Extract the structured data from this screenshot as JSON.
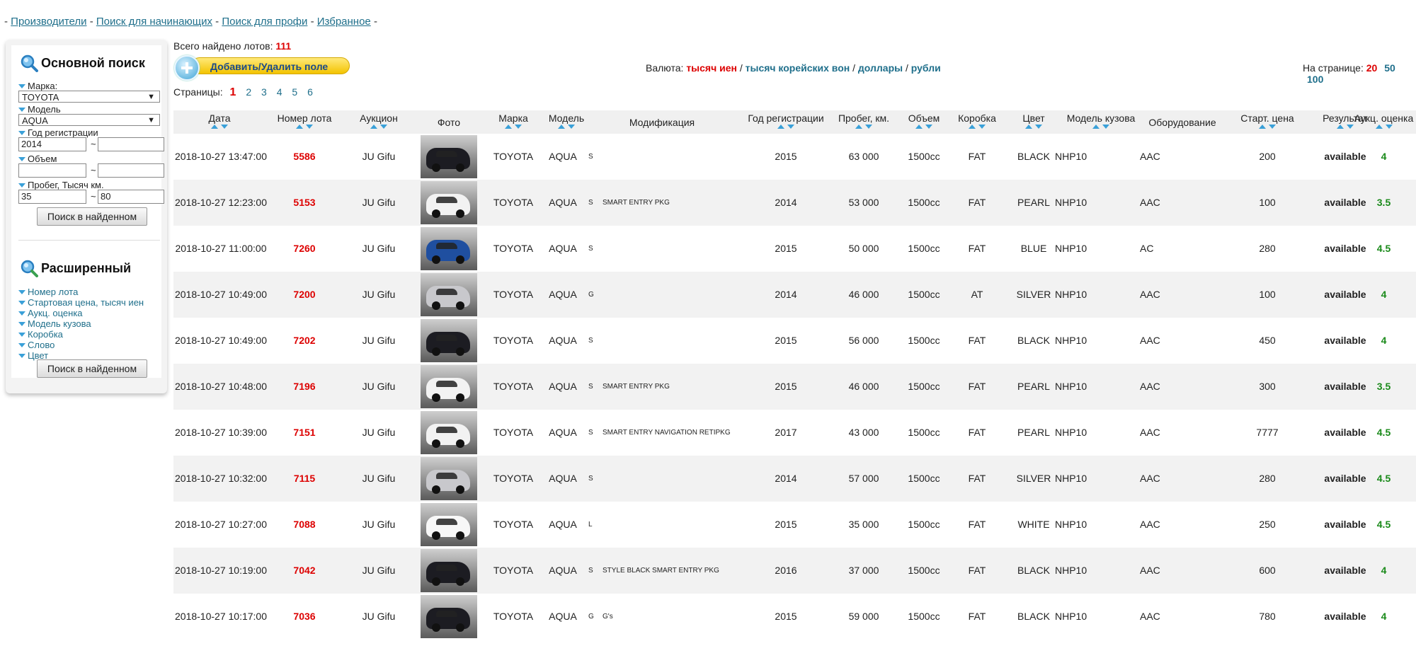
{
  "nav": {
    "prefix": "-",
    "links": [
      "Производители",
      "Поиск для начинающих",
      "Поиск для профи",
      "Избранное"
    ],
    "sep": "-"
  },
  "sidebar": {
    "basic_title": "Основной поиск",
    "make_label": "Марка:",
    "make_value": "TOYOTA",
    "model_label": "Модель",
    "model_value": "AQUA",
    "year_label": "Год регистрации",
    "year_from": "2014",
    "year_to": "",
    "volume_label": "Объем",
    "volume_from": "",
    "volume_to": "",
    "mileage_label": "Пробег, Тысяч км.",
    "mileage_from": "35",
    "mileage_to": "80",
    "tilde": "~",
    "search_button": "Поиск в найденном",
    "advanced_title": "Расширенный",
    "advanced_links": [
      "Номер лота",
      "Стартовая цена, тысяч иен",
      "Аукц. оценка",
      "Модель кузова",
      "Коробка",
      "Слово",
      "Цвет"
    ],
    "search_button_2": "Поиск в найденном"
  },
  "summary": {
    "found_label": "Всего найдено лотов:",
    "found_count": "111",
    "add_field_button": "Добавить/Удалить поле",
    "currency_label": "Валюта:",
    "currency_selected": "тысяч иен",
    "currency_options": [
      "тысяч корейских вон",
      "доллары",
      "рубли"
    ],
    "per_page_label": "На странице:",
    "per_page_selected": "20",
    "per_page_options": [
      "50",
      "100"
    ],
    "pages_label": "Страницы:",
    "current_page": "1",
    "pages": [
      "2",
      "3",
      "4",
      "5",
      "6"
    ]
  },
  "columns": [
    "Дата",
    "Номер лота",
    "Аукцион",
    "Фото",
    "Марка",
    "Модель",
    "Модификация",
    "Год регистрации",
    "Пробег, км.",
    "Объем",
    "Коробка",
    "Цвет",
    "Модель кузова",
    "Оборудование",
    "Старт. цена",
    "Результат",
    "Аукц. оценка"
  ],
  "rows": [
    {
      "date": "2018-10-27 13:47:00",
      "lot": "5586",
      "auction": "JU Gifu",
      "make": "TOYOTA",
      "model": "AQUA",
      "grade": "S",
      "mod": "",
      "year": "2015",
      "mileage": "63 000",
      "volume": "1500cc",
      "gearbox": "FAT",
      "color": "BLACK",
      "body": "NHP10",
      "equip": "AAC",
      "start": "200",
      "result": "available",
      "score": "4",
      "car_color": "#1c1c22"
    },
    {
      "date": "2018-10-27 12:23:00",
      "lot": "5153",
      "auction": "JU Gifu",
      "make": "TOYOTA",
      "model": "AQUA",
      "grade": "S",
      "mod": "SMART ENTRY PKG",
      "year": "2014",
      "mileage": "53 000",
      "volume": "1500cc",
      "gearbox": "FAT",
      "color": "PEARL",
      "body": "NHP10",
      "equip": "AAC",
      "start": "100",
      "result": "available",
      "score": "3.5",
      "car_color": "#f2f2f2"
    },
    {
      "date": "2018-10-27 11:00:00",
      "lot": "7260",
      "auction": "JU Gifu",
      "make": "TOYOTA",
      "model": "AQUA",
      "grade": "S",
      "mod": "",
      "year": "2015",
      "mileage": "50 000",
      "volume": "1500cc",
      "gearbox": "FAT",
      "color": "BLUE",
      "body": "NHP10",
      "equip": "AC",
      "start": "280",
      "result": "available",
      "score": "4.5",
      "car_color": "#1f4fa0"
    },
    {
      "date": "2018-10-27 10:49:00",
      "lot": "7200",
      "auction": "JU Gifu",
      "make": "TOYOTA",
      "model": "AQUA",
      "grade": "G",
      "mod": "",
      "year": "2014",
      "mileage": "46 000",
      "volume": "1500cc",
      "gearbox": "AT",
      "color": "SILVER",
      "body": "NHP10",
      "equip": "AAC",
      "start": "100",
      "result": "available",
      "score": "4",
      "car_color": "#c8c8cc"
    },
    {
      "date": "2018-10-27 10:49:00",
      "lot": "7202",
      "auction": "JU Gifu",
      "make": "TOYOTA",
      "model": "AQUA",
      "grade": "S",
      "mod": "",
      "year": "2015",
      "mileage": "56 000",
      "volume": "1500cc",
      "gearbox": "FAT",
      "color": "BLACK",
      "body": "NHP10",
      "equip": "AAC",
      "start": "450",
      "result": "available",
      "score": "4",
      "car_color": "#1c1c22"
    },
    {
      "date": "2018-10-27 10:48:00",
      "lot": "7196",
      "auction": "JU Gifu",
      "make": "TOYOTA",
      "model": "AQUA",
      "grade": "S",
      "mod": "SMART ENTRY PKG",
      "year": "2015",
      "mileage": "46 000",
      "volume": "1500cc",
      "gearbox": "FAT",
      "color": "PEARL",
      "body": "NHP10",
      "equip": "AAC",
      "start": "300",
      "result": "available",
      "score": "3.5",
      "car_color": "#f2f2f2"
    },
    {
      "date": "2018-10-27 10:39:00",
      "lot": "7151",
      "auction": "JU Gifu",
      "make": "TOYOTA",
      "model": "AQUA",
      "grade": "S",
      "mod": "SMART ENTRY NAVIGATION RETIPKG",
      "year": "2017",
      "mileage": "43 000",
      "volume": "1500cc",
      "gearbox": "FAT",
      "color": "PEARL",
      "body": "NHP10",
      "equip": "AAC",
      "start": "7777",
      "result": "available",
      "score": "4.5",
      "car_color": "#f2f2f2"
    },
    {
      "date": "2018-10-27 10:32:00",
      "lot": "7115",
      "auction": "JU Gifu",
      "make": "TOYOTA",
      "model": "AQUA",
      "grade": "S",
      "mod": "",
      "year": "2014",
      "mileage": "57 000",
      "volume": "1500cc",
      "gearbox": "FAT",
      "color": "SILVER",
      "body": "NHP10",
      "equip": "AAC",
      "start": "280",
      "result": "available",
      "score": "4.5",
      "car_color": "#c8c8cc"
    },
    {
      "date": "2018-10-27 10:27:00",
      "lot": "7088",
      "auction": "JU Gifu",
      "make": "TOYOTA",
      "model": "AQUA",
      "grade": "L",
      "mod": "",
      "year": "2015",
      "mileage": "35 000",
      "volume": "1500cc",
      "gearbox": "FAT",
      "color": "WHITE",
      "body": "NHP10",
      "equip": "AAC",
      "start": "250",
      "result": "available",
      "score": "4.5",
      "car_color": "#f7f7f7"
    },
    {
      "date": "2018-10-27 10:19:00",
      "lot": "7042",
      "auction": "JU Gifu",
      "make": "TOYOTA",
      "model": "AQUA",
      "grade": "S",
      "mod": "STYLE BLACK SMART ENTRY PKG",
      "year": "2016",
      "mileage": "37 000",
      "volume": "1500cc",
      "gearbox": "FAT",
      "color": "BLACK",
      "body": "NHP10",
      "equip": "AAC",
      "start": "600",
      "result": "available",
      "score": "4",
      "car_color": "#1c1c22"
    },
    {
      "date": "2018-10-27 10:17:00",
      "lot": "7036",
      "auction": "JU Gifu",
      "make": "TOYOTA",
      "model": "AQUA",
      "grade": "G",
      "mod": "G's",
      "year": "2015",
      "mileage": "59 000",
      "volume": "1500cc",
      "gearbox": "FAT",
      "color": "BLACK",
      "body": "NHP10",
      "equip": "AAC",
      "start": "780",
      "result": "available",
      "score": "4",
      "car_color": "#1c1c22"
    }
  ],
  "colors": {
    "accent_red": "#d00000",
    "link_blue": "#1f6f8b",
    "grade_green": "#1a8a1a",
    "sort_arrow": "#3aa0d8"
  }
}
